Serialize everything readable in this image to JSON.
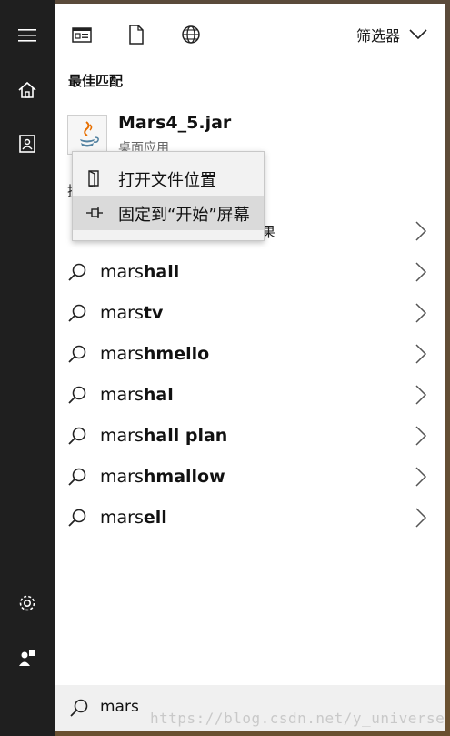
{
  "toolbar": {
    "filter_label": "筛选器"
  },
  "best_match": {
    "title": "最佳匹配",
    "app_name": "Mars4_5.jar",
    "app_type": "桌面应用"
  },
  "context_menu": {
    "items": [
      {
        "label": "打开文件位置"
      },
      {
        "label": "固定到“开始”屏幕"
      }
    ]
  },
  "suggestions": [
    {
      "prefix": "mars",
      "suffix": "hall"
    },
    {
      "prefix": "mars",
      "suffix": "tv"
    },
    {
      "prefix": "mars",
      "suffix": "hmello"
    },
    {
      "prefix": "mars",
      "suffix": "hal"
    },
    {
      "prefix": "mars",
      "suffix": "hall plan"
    },
    {
      "prefix": "mars",
      "suffix": "hmallow"
    },
    {
      "prefix": "mars",
      "suffix": "ell"
    }
  ],
  "partial": {
    "heading_char": "搜",
    "row_char": "果"
  },
  "search": {
    "query": "mars"
  },
  "watermark": "https://blog.csdn.net/y_universe"
}
